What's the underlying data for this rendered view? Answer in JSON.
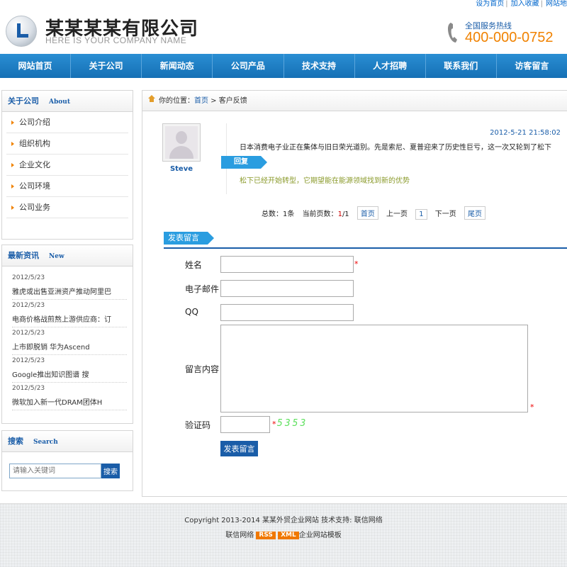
{
  "topbar": {
    "items": [
      "设为首页",
      "加入收藏",
      "网站地"
    ]
  },
  "header": {
    "company_name": "某某某某有限公司",
    "company_sub": "HERE IS YOUR COMPANY NAME",
    "hotline_label": "全国服务热线",
    "hotline_number": "400-000-0752"
  },
  "nav": [
    "网站首页",
    "关于公司",
    "新闻动态",
    "公司产品",
    "技术支持",
    "人才招聘",
    "联系我们",
    "访客留言"
  ],
  "sidebar": {
    "about": {
      "title_cn": "关于公司",
      "title_en": "About",
      "items": [
        "公司介绍",
        "组织机构",
        "企业文化",
        "公司环境",
        "公司业务"
      ]
    },
    "news": {
      "title_cn": "最新资讯",
      "title_en": "New",
      "items": [
        {
          "date": "2012/5/23",
          "title": "雅虎或出售亚洲资产推动阿里巴"
        },
        {
          "date": "2012/5/23",
          "title": "电商价格战煎熬上游供应商：订"
        },
        {
          "date": "2012/5/23",
          "title": "上市即脱销 华为Ascend"
        },
        {
          "date": "2012/5/23",
          "title": "Google推出知识图谱 搜"
        },
        {
          "date": "2012/5/23",
          "title": "微软加入新一代DRAM团体H"
        }
      ]
    },
    "search": {
      "title_cn": "搜索",
      "title_en": "Search",
      "placeholder": "请输入关键词",
      "button": "搜索"
    }
  },
  "breadcrumb": {
    "label": "你的位置：",
    "home": "首页",
    "sep": " > ",
    "current": "客户反馈"
  },
  "message": {
    "user": "Steve",
    "time": "2012-5-21 21:58:02",
    "text": "日本消费电子业正在集体与旧日荣光道别。先是索尼、夏普迎来了历史性巨亏，这一次又轮到了松下",
    "reply_label": "回复",
    "reply_text": "松下已经开始转型，它期望能在能源领域找到新的优势"
  },
  "pager": {
    "total_prefix": "总数：",
    "total": "1条",
    "current_prefix": "当前页数：",
    "current": "1",
    "pages": "/1",
    "first": "首页",
    "prev": "上一页",
    "page_num": "1",
    "next": "下一页",
    "last": "尾页"
  },
  "form": {
    "title": "发表留言",
    "name_label": "姓名",
    "email_label": "电子邮件",
    "qq_label": "QQ",
    "content_label": "留言内容",
    "captcha_label": "验证码",
    "required_mark": "*",
    "captcha_code": "5353",
    "submit": "发表留言"
  },
  "footer": {
    "copyright": "Copyright 2013-2014 某某外贸企业网站 技术支持: 联信网络",
    "line2_prefix": "联信网络",
    "rss": "RSS",
    "xml": "XML",
    "line2_suffix": "企业网站模板"
  },
  "colors": {
    "nav_blue": "#1570b5",
    "accent_blue": "#2a9de0",
    "hotline_orange": "#f08200",
    "link_blue": "#1a5da8"
  }
}
